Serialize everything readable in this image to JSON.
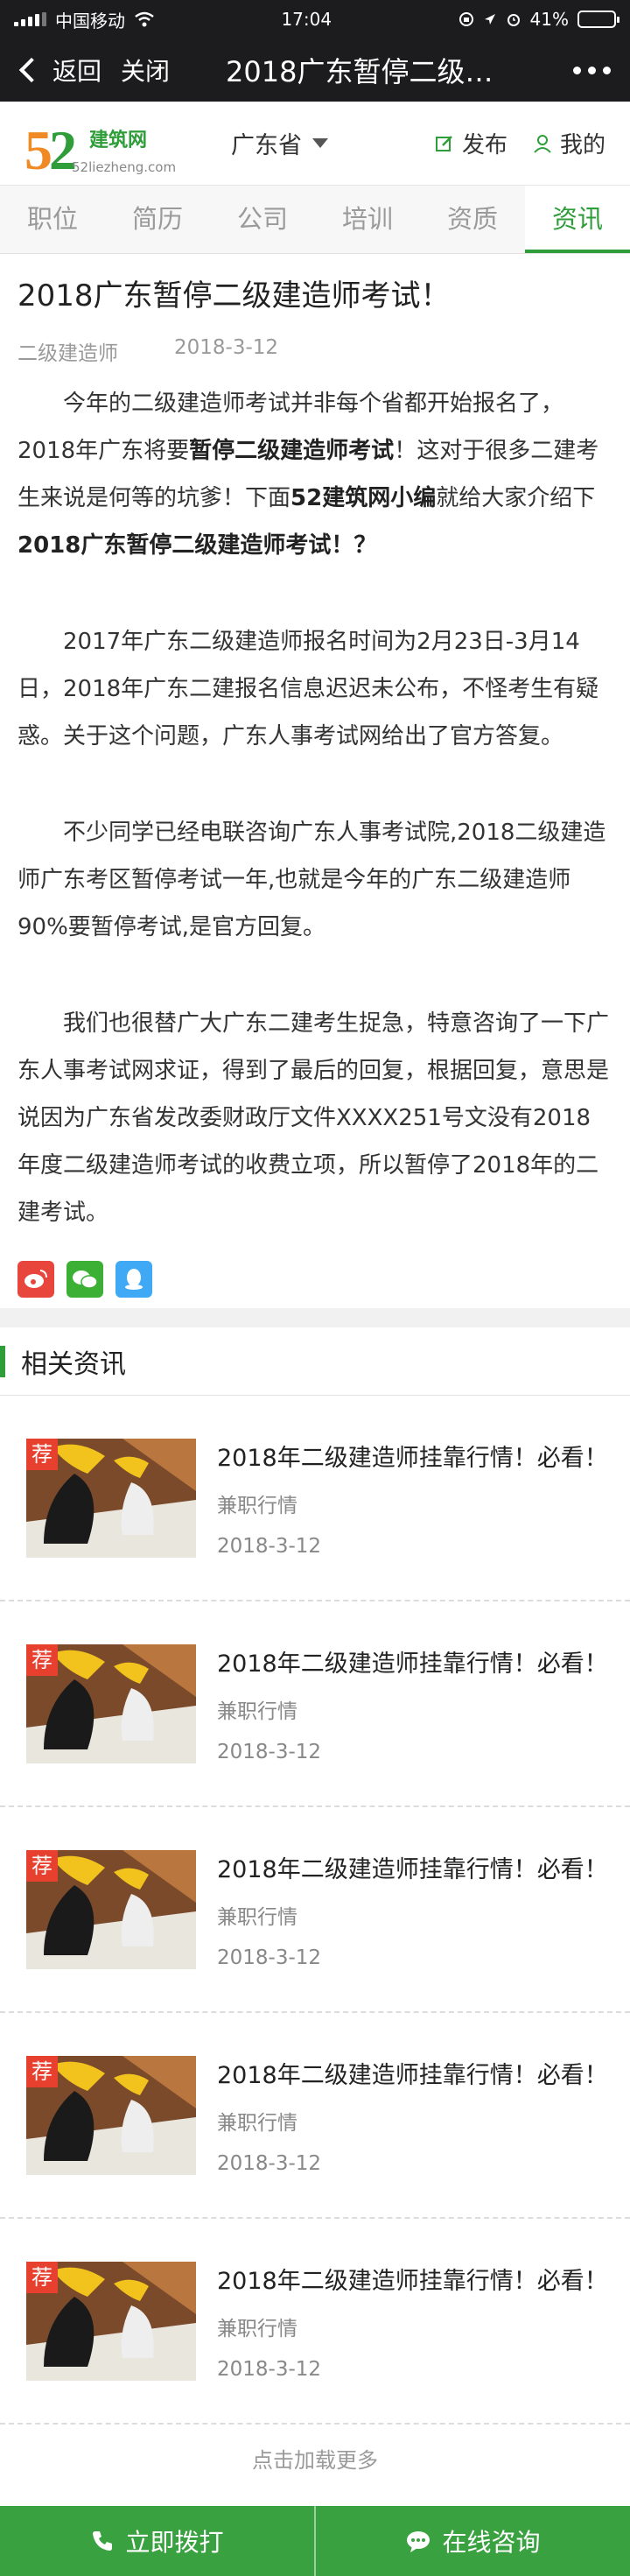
{
  "status_bar": {
    "carrier": "中国移动",
    "time": "17:04",
    "battery": "41%"
  },
  "navbar": {
    "back_label": "返回",
    "close_label": "关闭",
    "title": "2018广东暂停二级…"
  },
  "site": {
    "logo_num5": "5",
    "logo_num2": "2",
    "logo_text": "建筑网",
    "logo_domain": "52liezheng.com",
    "region": "广东省",
    "publish": "发布",
    "mine": "我的"
  },
  "tabs": [
    {
      "label": "职位"
    },
    {
      "label": "简历"
    },
    {
      "label": "公司"
    },
    {
      "label": "培训"
    },
    {
      "label": "资质"
    },
    {
      "label": "资讯"
    }
  ],
  "article": {
    "title": "2018广东暂停二级建造师考试！",
    "category": "二级建造师",
    "date": "2018-3-12",
    "p1_a": "今年的二级建造师考试并非每个省都开始报名了，2018年广东将要",
    "p1_b": "暂停二级建造师考试",
    "p1_c": "！这对于很多二建考生来说是何等的坑爹！下面",
    "p1_d": "52建筑网小编",
    "p1_e": "就给大家介绍下",
    "p1_f": "2018广东暂停二级建造师考试！？",
    "p2": "2017年广东二级建造师报名时间为2月23日-3月14日，2018年广东二建报名信息迟迟未公布，不怪考生有疑惑。关于这个问题，广东人事考试网给出了官方答复。",
    "p3": "不少同学已经电联咨询广东人事考试院,2018二级建造师广东考区暂停考试一年,也就是今年的广东二级建造师90%要暂停考试,是官方回复。",
    "p4": "我们也很替广大广东二建考生捉急，特意咨询了一下广东人事考试网求证，得到了最后的回复，根据回复，意思是说因为广东省发改委财政厅文件XXXX251号文没有2018年度二级建造师考试的收费立项，所以暂停了2018年的二建考试。"
  },
  "related": {
    "title": "相关资讯",
    "badge": "荐",
    "items": [
      {
        "title": "2018年二级建造师挂靠行情！必看！",
        "category": "兼职行情",
        "date": "2018-3-12"
      },
      {
        "title": "2018年二级建造师挂靠行情！必看！",
        "category": "兼职行情",
        "date": "2018-3-12"
      },
      {
        "title": "2018年二级建造师挂靠行情！必看！",
        "category": "兼职行情",
        "date": "2018-3-12"
      },
      {
        "title": "2018年二级建造师挂靠行情！必看！",
        "category": "兼职行情",
        "date": "2018-3-12"
      },
      {
        "title": "2018年二级建造师挂靠行情！必看！",
        "category": "兼职行情",
        "date": "2018-3-12"
      }
    ],
    "load_more": "点击加载更多"
  },
  "bottom": {
    "call": "立即拨打",
    "consult": "在线咨询"
  },
  "colors": {
    "brand_green": "#2f9d3a",
    "accent_orange": "#f08a24",
    "badge_red": "#e8402e"
  }
}
